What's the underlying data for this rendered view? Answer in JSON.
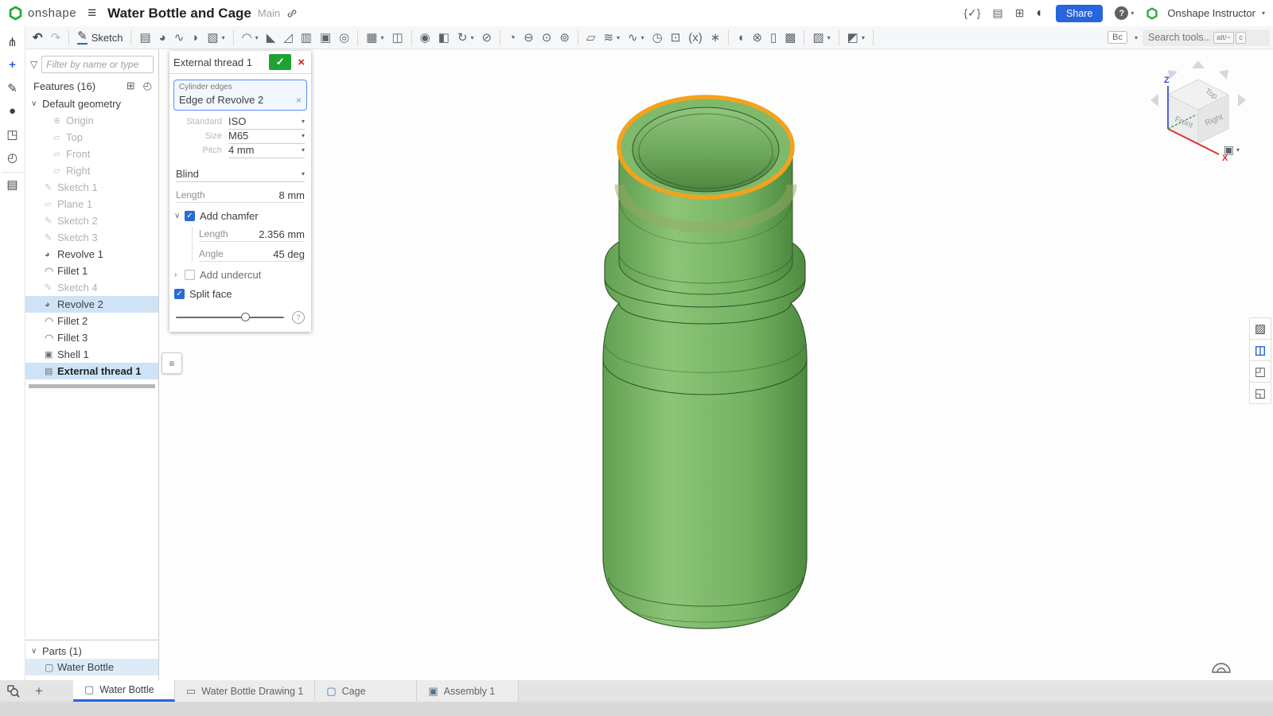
{
  "header": {
    "app_name": "onshape",
    "document_title": "Water Bottle and Cage",
    "workspace": "Main",
    "share_label": "Share",
    "help_label": "?",
    "user_name": "Onshape Instructor",
    "right_icons": [
      {
        "glyph": "{✓}",
        "name": "featurescript-icon"
      },
      {
        "glyph": "▤",
        "name": "release-management-icon"
      },
      {
        "glyph": "⊞",
        "name": "app-store-icon"
      },
      {
        "glyph": "◐",
        "name": "language-icon",
        "dark": true
      }
    ]
  },
  "toolbar": {
    "bc_label": "Bc",
    "search_placeholder": "Search tools...",
    "kbd1": "alt/~",
    "kbd2": "c",
    "items": [
      {
        "glyph": "↶",
        "name": "undo-button"
      },
      {
        "glyph": "↷",
        "name": "redo-button",
        "muted": true
      },
      {
        "divider": true
      },
      {
        "glyph": "✎",
        "label": "Sketch",
        "name": "sketch-button"
      },
      {
        "divider": true
      },
      {
        "glyph": "▤",
        "name": "extrude-button"
      },
      {
        "glyph": "◕",
        "name": "revolve-button"
      },
      {
        "glyph": "∿",
        "name": "sweep-button"
      },
      {
        "glyph": "◗",
        "name": "loft-button"
      },
      {
        "glyph": "▧",
        "name": "thicken-button",
        "caret": true
      },
      {
        "divider": true
      },
      {
        "glyph": "◠",
        "name": "fillet-button",
        "caret": true
      },
      {
        "glyph": "◣",
        "name": "chamfer-button"
      },
      {
        "glyph": "◿",
        "name": "draft-button"
      },
      {
        "glyph": "▥",
        "name": "rib-button"
      },
      {
        "glyph": "▣",
        "name": "shell-button"
      },
      {
        "glyph": "◎",
        "name": "hole-button"
      },
      {
        "divider": true
      },
      {
        "glyph": "▦",
        "name": "linear-pattern-button",
        "caret": true
      },
      {
        "glyph": "◫",
        "name": "mirror-button"
      },
      {
        "divider": true
      },
      {
        "glyph": "◉",
        "name": "boolean-button"
      },
      {
        "glyph": "◧",
        "name": "split-button"
      },
      {
        "glyph": "↻",
        "name": "transform-button",
        "caret": true
      },
      {
        "glyph": "⊘",
        "name": "delete-part-button"
      },
      {
        "divider": true
      },
      {
        "glyph": "◔",
        "name": "modify-fillet-button"
      },
      {
        "glyph": "⊖",
        "name": "delete-face-button"
      },
      {
        "glyph": "⊙",
        "name": "move-face-button"
      },
      {
        "glyph": "⊚",
        "name": "offset-surface-button"
      },
      {
        "divider": true
      },
      {
        "glyph": "▱",
        "name": "plane-button"
      },
      {
        "glyph": "≋",
        "name": "helix-button",
        "caret": true
      },
      {
        "glyph": "∿",
        "name": "spline-button",
        "caret": true
      },
      {
        "glyph": "◷",
        "name": "circular-pattern-button"
      },
      {
        "glyph": "⊡",
        "name": "projected-curve-button"
      },
      {
        "glyph": "(x)",
        "name": "variable-button"
      },
      {
        "glyph": "∗",
        "name": "variable-studio-button"
      },
      {
        "divider": true
      },
      {
        "glyph": "◖",
        "name": "sheet-metal-model-button"
      },
      {
        "glyph": "⊗",
        "name": "sheet-metal-flat-button"
      },
      {
        "glyph": "▯",
        "name": "sheet-metal-table-button"
      },
      {
        "glyph": "▩",
        "name": "frame-button"
      },
      {
        "divider": true
      },
      {
        "glyph": "▨",
        "name": "custom-features-button",
        "caret": true
      },
      {
        "divider": true
      },
      {
        "glyph": "◩",
        "name": "surface-tools-button",
        "caret": true
      },
      {
        "divider": true
      }
    ]
  },
  "left_rail": {
    "items": [
      {
        "glyph": "⋔",
        "name": "versions-icon"
      },
      {
        "glyph": "+",
        "name": "insert-items-icon",
        "blue": true
      },
      {
        "glyph": "✎",
        "name": "markup-icon"
      },
      {
        "glyph": "●",
        "name": "comments-icon"
      },
      {
        "glyph": "◳",
        "name": "learning-icon"
      },
      {
        "glyph": "◴",
        "name": "history-icon"
      },
      {
        "glyph": "▤",
        "name": "checklist-icon"
      }
    ]
  },
  "feature_panel": {
    "filter_placeholder": "Filter by name or type",
    "features_header": "Features (16)",
    "parts_header": "Parts (1)",
    "tree": [
      {
        "label": "Default geometry",
        "twist": "∨",
        "group": true,
        "name": "feature-default-geometry"
      },
      {
        "label": "Origin",
        "icon": "origin",
        "muted": true,
        "child": true,
        "name": "feature-origin"
      },
      {
        "label": "Top",
        "icon": "plane",
        "muted": true,
        "child": true,
        "name": "feature-top-plane"
      },
      {
        "label": "Front",
        "icon": "plane",
        "muted": true,
        "child": true,
        "name": "feature-front-plane"
      },
      {
        "label": "Right",
        "icon": "plane",
        "muted": true,
        "child": true,
        "name": "feature-right-plane"
      },
      {
        "label": "Sketch 1",
        "icon": "sketch",
        "muted": true,
        "name": "feature-sketch-1"
      },
      {
        "label": "Plane 1",
        "icon": "plane",
        "muted": true,
        "name": "feature-plane-1"
      },
      {
        "label": "Sketch 2",
        "icon": "sketch",
        "muted": true,
        "name": "feature-sketch-2"
      },
      {
        "label": "Sketch 3",
        "icon": "sketch",
        "muted": true,
        "name": "feature-sketch-3"
      },
      {
        "label": "Revolve 1",
        "icon": "revolve",
        "name": "feature-revolve-1"
      },
      {
        "label": "Fillet 1",
        "icon": "fillet",
        "name": "feature-fillet-1"
      },
      {
        "label": "Sketch 4",
        "icon": "sketch",
        "muted": true,
        "name": "feature-sketch-4"
      },
      {
        "label": "Revolve 2",
        "icon": "revolve",
        "selected": true,
        "name": "feature-revolve-2"
      },
      {
        "label": "Fillet 2",
        "icon": "fillet",
        "name": "feature-fillet-2"
      },
      {
        "label": "Fillet 3",
        "icon": "fillet",
        "name": "feature-fillet-3"
      },
      {
        "label": "Shell 1",
        "icon": "shell",
        "name": "feature-shell-1"
      },
      {
        "label": "External thread 1",
        "icon": "thread",
        "selected": true,
        "bold": true,
        "name": "feature-external-thread-1"
      }
    ],
    "parts": [
      {
        "label": "Water Bottle",
        "icon": "part",
        "selected": true,
        "name": "part-water-bottle"
      }
    ]
  },
  "dialog": {
    "title": "External thread 1",
    "accept_glyph": "✓",
    "cancel_glyph": "×",
    "selection_label": "Cylinder edges",
    "selection_value": "Edge of Revolve 2",
    "selection_clear_glyph": "×",
    "selects": [
      {
        "label": "Standard",
        "value": "ISO",
        "name": "standard-select"
      },
      {
        "label": "Size",
        "value": "M65",
        "name": "size-select"
      },
      {
        "label": "Pitch",
        "value": "4 mm",
        "name": "pitch-select"
      }
    ],
    "end_type": "Blind",
    "length_label": "Length",
    "length_value": "8 mm",
    "chamfer_label": "Add chamfer",
    "chamfer_length_label": "Length",
    "chamfer_length_value": "2.356 mm",
    "chamfer_angle_label": "Angle",
    "chamfer_angle_value": "45 deg",
    "undercut_label": "Add undercut",
    "split_face_label": "Split face"
  },
  "viewcube": {
    "top": "Top",
    "front": "Front",
    "right": "Right",
    "z": "Z",
    "x": "X"
  },
  "tabs": [
    {
      "glyph": "▢",
      "label": "Water Bottle",
      "active": true,
      "name": "tab-water-bottle"
    },
    {
      "glyph": "▭",
      "label": "Water Bottle Drawing 1",
      "name": "tab-water-bottle-drawing-1"
    },
    {
      "glyph": "▢",
      "label": "Cage",
      "name": "tab-cage"
    },
    {
      "glyph": "▣",
      "label": "Assembly 1",
      "name": "tab-assembly-1"
    }
  ],
  "colors": {
    "accent_blue": "#2864dc",
    "confirm_green": "#1fa233",
    "cancel_red": "#c5281c",
    "selection_row_blue": "#cfe3f6",
    "highlight_edge_orange": "#f3a21d",
    "bottle_green": "#7cb96a",
    "logo_green": "#27a737"
  }
}
